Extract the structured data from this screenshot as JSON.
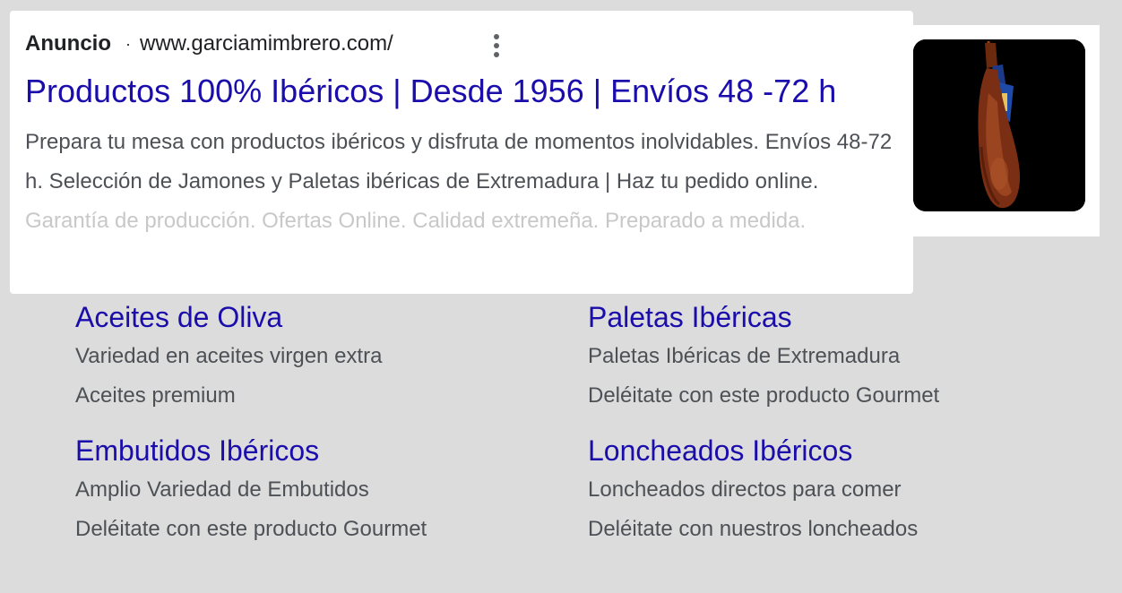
{
  "ad": {
    "label": "Anuncio",
    "separator": "·",
    "url": "www.garciamimbrero.com/",
    "title": "Productos 100% Ibéricos | Desde 1956 | Envíos 48 -72 h",
    "description_visible": "Prepara tu mesa con productos ibéricos y disfruta de momentos inolvidables. Envíos 48-72 h. Selección de Jamones y Paletas ibéricas de Extremadura | Haz tu pedido online.",
    "description_faded": "Garantía de producción. Ofertas Online. Calidad extremeña. Preparado a medida.",
    "thumbnail_icon": "jamon-image"
  },
  "sitelinks": [
    {
      "title": "Aceites de Oliva",
      "line1": "Variedad en aceites virgen extra",
      "line2": "Aceites premium"
    },
    {
      "title": "Paletas Ibéricas",
      "line1": "Paletas Ibéricas de Extremadura",
      "line2": "Deléitate con este producto Gourmet"
    },
    {
      "title": "Embutidos Ibéricos",
      "line1": "Amplio Variedad de Embutidos",
      "line2": "Deléitate con este producto Gourmet"
    },
    {
      "title": "Loncheados Ibéricos",
      "line1": "Loncheados directos para comer",
      "line2": "Deléitate con nuestros loncheados"
    }
  ],
  "colors": {
    "link_blue": "#1a0dab",
    "text_gray": "#4d5156",
    "faded_text": "#c8c8c8",
    "background": "#dcdcdc"
  }
}
